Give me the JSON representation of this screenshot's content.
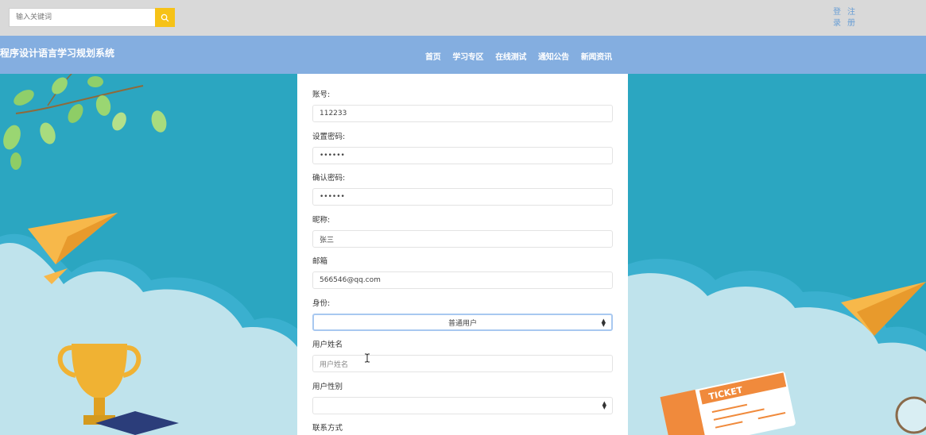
{
  "header": {
    "search_placeholder": "输入关键词",
    "login_chars": [
      "登",
      "录"
    ],
    "register_chars": [
      "注",
      "册"
    ]
  },
  "nav": {
    "site_title": "程序设计语言学习规划系统",
    "items": [
      "首页",
      "学习专区",
      "在线测试",
      "通知公告",
      "新闻资讯"
    ]
  },
  "form": {
    "account": {
      "label": "账号:",
      "value": "112233"
    },
    "password": {
      "label": "设置密码:",
      "value": "••••••"
    },
    "confirm_password": {
      "label": "确认密码:",
      "value": "••••••"
    },
    "nickname": {
      "label": "昵称:",
      "value": "张三"
    },
    "email": {
      "label": "邮箱",
      "value": "566546@qq.com"
    },
    "role": {
      "label": "身份:",
      "value": "普通用户"
    },
    "real_name": {
      "label": "用户姓名",
      "placeholder": "用户姓名"
    },
    "gender": {
      "label": "用户性别",
      "value": ""
    },
    "contact": {
      "label": "联系方式"
    }
  },
  "decor": {
    "ticket_text": "TICKET"
  },
  "colors": {
    "topbar": "#d9d9d9",
    "navbar": "#84aee0",
    "search_button": "#f6c217",
    "background": "#2ba6c1",
    "auth_link": "#6a9fd5"
  }
}
